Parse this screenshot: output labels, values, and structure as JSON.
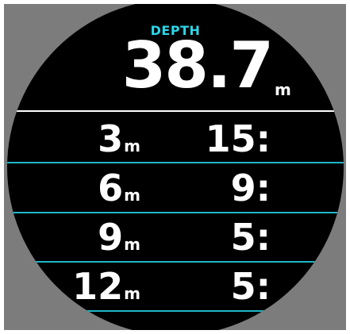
{
  "depth": {
    "label": "DEPTH",
    "value": "38.7",
    "unit": "m"
  },
  "stops": [
    {
      "depth": "3",
      "unit": "m",
      "time": "15:"
    },
    {
      "depth": "6",
      "unit": "m",
      "time": "9:"
    },
    {
      "depth": "9",
      "unit": "m",
      "time": "5:"
    },
    {
      "depth": "12",
      "unit": "m",
      "time": "5:"
    }
  ],
  "colors": {
    "accent": "#2ad6e8",
    "divider": "#1fb7c8",
    "bezel": "#7c7c7c",
    "screen": "#000000",
    "text": "#ffffff"
  }
}
